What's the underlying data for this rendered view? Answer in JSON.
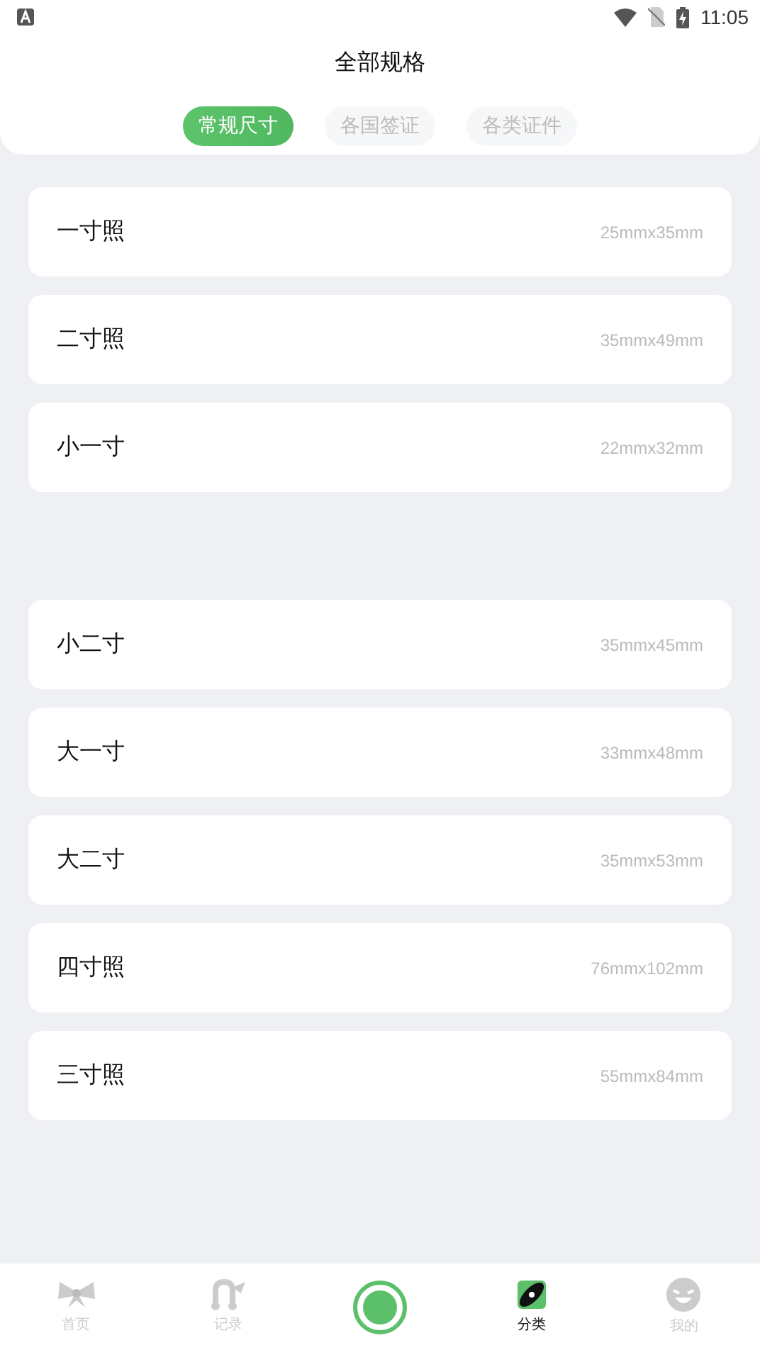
{
  "status_bar": {
    "time": "11:05"
  },
  "header": {
    "title": "全部规格"
  },
  "tabs": [
    {
      "label": "常规尺寸",
      "selected": true
    },
    {
      "label": "各国签证",
      "selected": false
    },
    {
      "label": "各类证件",
      "selected": false
    }
  ],
  "spec_groups": [
    {
      "items": [
        {
          "name": "一寸照",
          "size": "25mmx35mm"
        },
        {
          "name": "二寸照",
          "size": "35mmx49mm"
        },
        {
          "name": "小一寸",
          "size": "22mmx32mm"
        }
      ]
    },
    {
      "items": [
        {
          "name": "小二寸",
          "size": "35mmx45mm"
        },
        {
          "name": "大一寸",
          "size": "33mmx48mm"
        },
        {
          "name": "大二寸",
          "size": "35mmx53mm"
        },
        {
          "name": "四寸照",
          "size": "76mmx102mm"
        },
        {
          "name": "三寸照",
          "size": "55mmx84mm"
        }
      ]
    }
  ],
  "bottom_nav": [
    {
      "kind": "home",
      "label": "首页",
      "selected": false
    },
    {
      "kind": "records",
      "label": "记录",
      "selected": false
    },
    {
      "kind": "capture"
    },
    {
      "kind": "category",
      "label": "分类",
      "selected": true
    },
    {
      "kind": "profile",
      "label": "我的",
      "selected": false
    }
  ]
}
